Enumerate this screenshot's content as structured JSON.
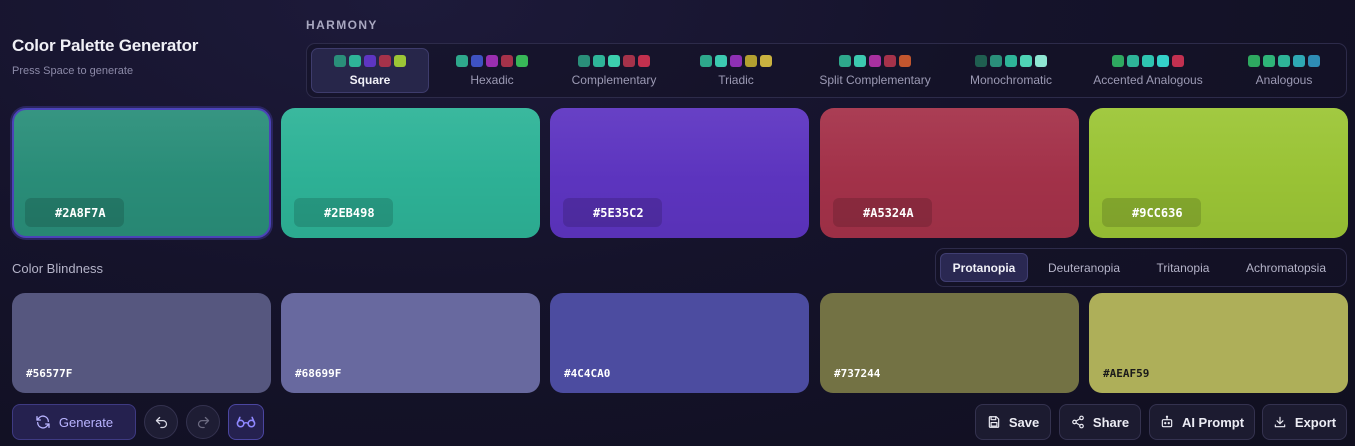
{
  "app": {
    "title": "Color Palette Generator",
    "subtitle": "Press Space to generate"
  },
  "harmony": {
    "label": "HARMONY",
    "options": [
      {
        "label": "Square",
        "active": true,
        "swatches": [
          "#2A8F7A",
          "#2EB498",
          "#5E35C2",
          "#A5324A",
          "#9CC636"
        ]
      },
      {
        "label": "Hexadic",
        "active": false,
        "swatches": [
          "#2EA88C",
          "#3E52C2",
          "#9A2EB0",
          "#A5324A",
          "#38B858"
        ]
      },
      {
        "label": "Complementary",
        "active": false,
        "swatches": [
          "#2A8F7A",
          "#2EB498",
          "#3CCFAE",
          "#A5324A",
          "#C2304E"
        ]
      },
      {
        "label": "Triadic",
        "active": false,
        "swatches": [
          "#2EA88C",
          "#3CC9B0",
          "#8E30B4",
          "#B2A030",
          "#C9B240"
        ]
      },
      {
        "label": "Split Complementary",
        "active": false,
        "swatches": [
          "#2EA88C",
          "#3CC9B0",
          "#A830A0",
          "#A5324A",
          "#C2562E"
        ]
      },
      {
        "label": "Monochromatic",
        "active": false,
        "swatches": [
          "#1F5E50",
          "#2A8F7A",
          "#2EB498",
          "#4FD3B6",
          "#8FE6D3"
        ]
      },
      {
        "label": "Accented Analogous",
        "active": false,
        "swatches": [
          "#2EA860",
          "#2EB498",
          "#2EC4B0",
          "#34D0C8",
          "#C23050"
        ]
      },
      {
        "label": "Analogous",
        "active": false,
        "swatches": [
          "#2EA860",
          "#2EB478",
          "#2EB498",
          "#2EA8B4",
          "#2E8CB4"
        ]
      }
    ]
  },
  "palette": [
    {
      "hex": "#2A8F7A",
      "color": "#2A8F7A",
      "selected": true
    },
    {
      "hex": "#2EB498",
      "color": "#2EB498",
      "selected": false
    },
    {
      "hex": "#5E35C2",
      "color": "#5E35C2",
      "selected": false
    },
    {
      "hex": "#A5324A",
      "color": "#A5324A",
      "selected": false
    },
    {
      "hex": "#9CC636",
      "color": "#9CC636",
      "selected": false
    }
  ],
  "color_blindness": {
    "label": "Color Blindness",
    "modes": [
      {
        "label": "Protanopia",
        "active": true
      },
      {
        "label": "Deuteranopia",
        "active": false
      },
      {
        "label": "Tritanopia",
        "active": false
      },
      {
        "label": "Achromatopsia",
        "active": false
      }
    ],
    "simulated": [
      {
        "hex": "#56577F",
        "color": "#56577F",
        "text_color": "#ffffff"
      },
      {
        "hex": "#68699F",
        "color": "#68699F",
        "text_color": "#ffffff"
      },
      {
        "hex": "#4C4CA0",
        "color": "#4C4CA0",
        "text_color": "#ffffff"
      },
      {
        "hex": "#737244",
        "color": "#737244",
        "text_color": "#ffffff"
      },
      {
        "hex": "#AEAF59",
        "color": "#AEAF59",
        "text_color": "#1a1a1a"
      }
    ]
  },
  "toolbar": {
    "generate_label": "Generate",
    "generate_icon": "refresh-icon",
    "undo_icon": "undo-icon",
    "redo_icon": "redo-icon",
    "view_icon": "glasses-icon",
    "save_label": "Save",
    "share_label": "Share",
    "ai_prompt_label": "AI Prompt",
    "export_label": "Export"
  },
  "colors": {
    "accent": "#7B73FF",
    "background": "#15132B"
  }
}
